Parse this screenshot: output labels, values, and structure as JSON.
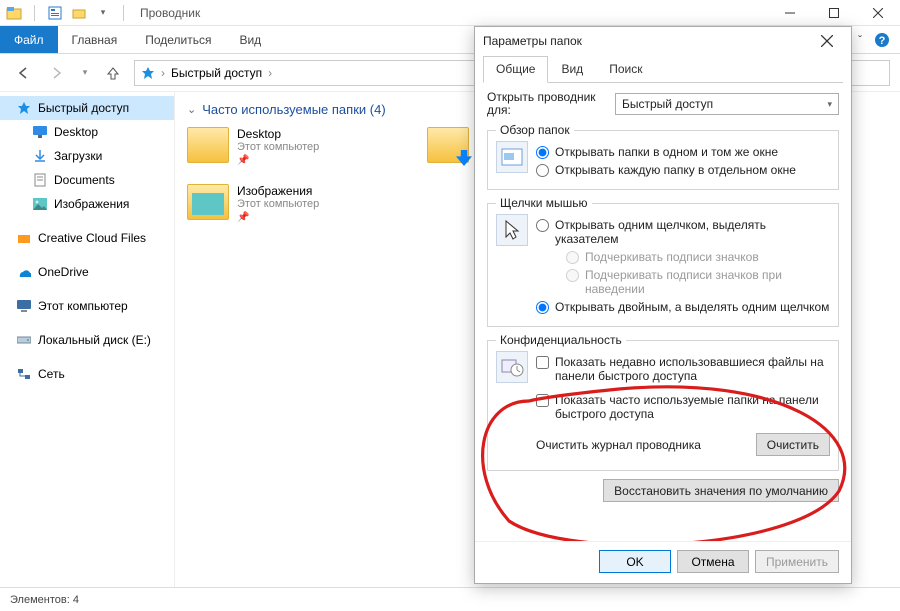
{
  "window": {
    "title": "Проводник",
    "qat_props": "Свойства",
    "qat_new": "Создать папку"
  },
  "ribbon": {
    "file": "Файл",
    "tabs": [
      "Главная",
      "Поделиться",
      "Вид"
    ],
    "collapse_hint": "ˇ"
  },
  "addressbar": {
    "crumb_root": "Быстрый доступ",
    "sep": "›"
  },
  "sidebar": {
    "quick": "Быстрый доступ",
    "items": [
      {
        "label": "Desktop"
      },
      {
        "label": "Загрузки"
      },
      {
        "label": "Documents"
      },
      {
        "label": "Изображения"
      },
      {
        "label": "Creative Cloud Files"
      },
      {
        "label": "OneDrive"
      },
      {
        "label": "Этот компьютер"
      },
      {
        "label": "Локальный диск (E:)"
      },
      {
        "label": "Сеть"
      }
    ]
  },
  "main": {
    "section": "Часто используемые папки (4)",
    "folders": [
      {
        "name": "Desktop",
        "sub": "Этот компьютер"
      },
      {
        "name": "Загрузки",
        "sub": ""
      },
      {
        "name": "Изображения",
        "sub": "Этот компьютер"
      }
    ]
  },
  "statusbar": {
    "text": "Элементов: 4"
  },
  "dialog": {
    "title": "Параметры папок",
    "tabs": {
      "general": "Общие",
      "view": "Вид",
      "search": "Поиск"
    },
    "open_for_label": "Открыть проводник для:",
    "open_for_value": "Быстрый доступ",
    "browse": {
      "legend": "Обзор папок",
      "opt_same": "Открывать папки в одном и том же окне",
      "opt_new": "Открывать каждую папку в отдельном окне"
    },
    "clicks": {
      "legend": "Щелчки мышью",
      "single": "Открывать одним щелчком, выделять указателем",
      "underline_icons": "Подчеркивать подписи значков",
      "underline_hover": "Подчеркивать подписи значков при наведении",
      "double": "Открывать двойным, а выделять одним щелчком"
    },
    "privacy": {
      "legend": "Конфиденциальность",
      "recent_files": "Показать недавно использовавшиеся файлы на панели быстрого доступа",
      "frequent_folders": "Показать часто используемые папки на панели быстрого доступа",
      "clear_label": "Очистить журнал проводника",
      "clear_btn": "Очистить"
    },
    "restore": "Восстановить значения по умолчанию",
    "ok": "OK",
    "cancel": "Отмена",
    "apply": "Применить"
  }
}
